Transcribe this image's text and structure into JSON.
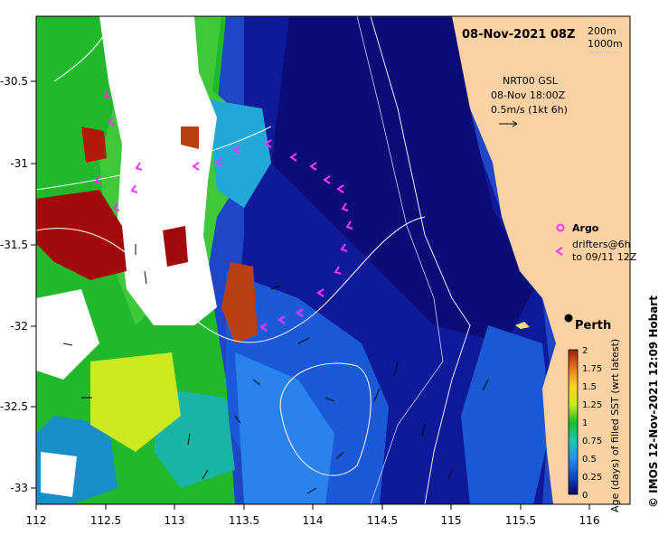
{
  "map": {
    "timestamp": "08-Nov-2021 08Z",
    "isobaths": [
      "200m",
      "1000m"
    ],
    "current_source": "NRT00 GSL",
    "current_time": "08-Nov 18:00Z",
    "current_scale": "0.5m/s (1kt 6h)",
    "city": "Perth",
    "legend_argo": "Argo",
    "legend_drifters_line1": "drifters@6h",
    "legend_drifters_line2": "to 09/11 12Z",
    "credit": "© IMOS 12-Nov-2021 12:09 Hobart",
    "x_ticks": [
      "112",
      "112.5",
      "113",
      "113.5",
      "114",
      "114.5",
      "115",
      "115.5",
      "116"
    ],
    "y_ticks": [
      "-30.5",
      "-31",
      "-31.5",
      "-32",
      "-32.5",
      "-33"
    ],
    "colorbar": {
      "label": "Age (days) of filled SST (wrt latest)",
      "ticks": [
        "0",
        "0.25",
        "0.5",
        "0.75",
        "1",
        "1.25",
        "1.5",
        "1.75",
        "2"
      ]
    },
    "colors": {
      "land": "#fcd2a4",
      "deep_ocean": "#101080",
      "argo": "#ff33ff",
      "drifters": "#ff33ff"
    }
  }
}
